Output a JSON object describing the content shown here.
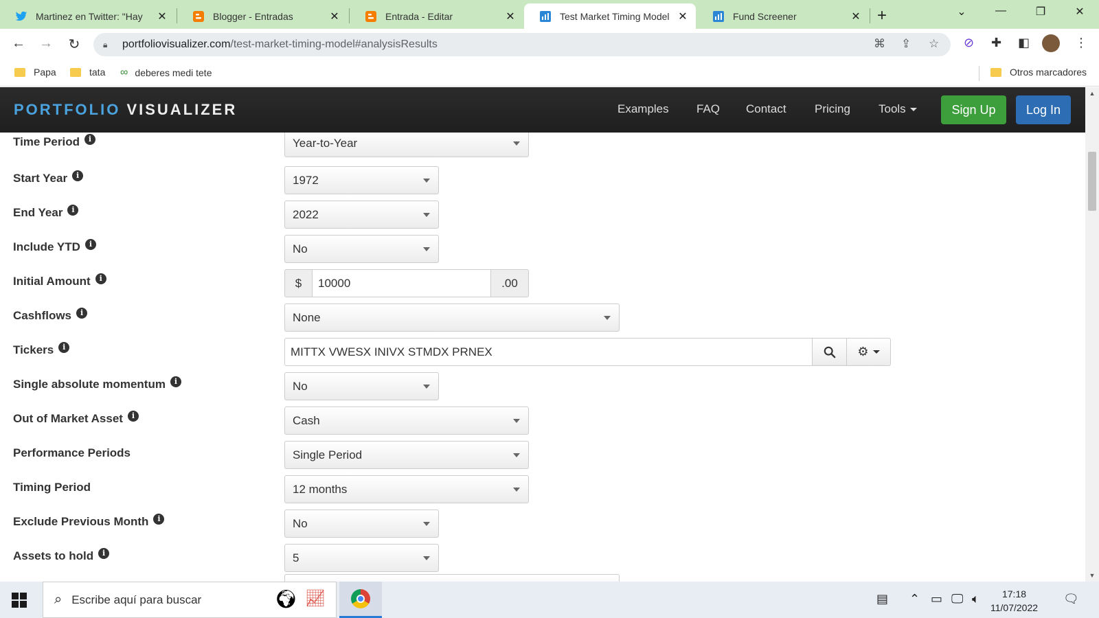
{
  "browser": {
    "tabs": [
      {
        "title": "Martinez en Twitter: \"Hay",
        "icon": "twitter-icon",
        "active": false
      },
      {
        "title": "Blogger - Entradas",
        "icon": "blogger-icon",
        "active": false
      },
      {
        "title": "Entrada - Editar",
        "icon": "blogger-icon",
        "active": false
      },
      {
        "title": "Test Market Timing Model",
        "icon": "portfolio-visualizer-icon",
        "active": true
      },
      {
        "title": "Fund Screener",
        "icon": "portfolio-visualizer-icon",
        "active": false
      }
    ],
    "url_host": "portfoliovisualizer.com",
    "url_path": "/test-market-timing-model#analysisResults",
    "bookmarks": [
      "Papa",
      "tata",
      "deberes medi tete"
    ],
    "other_bookmarks": "Otros marcadores"
  },
  "site": {
    "brand_part1": "PORTFOLIO",
    "brand_part2": "VISUALIZER",
    "nav": {
      "examples": "Examples",
      "faq": "FAQ",
      "contact": "Contact",
      "pricing": "Pricing",
      "tools": "Tools",
      "signup": "Sign Up",
      "login": "Log In"
    }
  },
  "form": {
    "time_period": {
      "label": "Time Period",
      "value": "Year-to-Year"
    },
    "start_year": {
      "label": "Start Year",
      "value": "1972"
    },
    "end_year": {
      "label": "End Year",
      "value": "2022"
    },
    "include_ytd": {
      "label": "Include YTD",
      "value": "No"
    },
    "initial_amount": {
      "label": "Initial Amount",
      "prefix": "$",
      "value": "10000",
      "suffix": ".00"
    },
    "cashflows": {
      "label": "Cashflows",
      "value": "None"
    },
    "tickers": {
      "label": "Tickers",
      "value": "MITTX VWESX INIVX STMDX PRNEX"
    },
    "single_abs_momentum": {
      "label": "Single absolute momentum",
      "value": "No"
    },
    "out_of_market_asset": {
      "label": "Out of Market Asset",
      "value": "Cash"
    },
    "performance_periods": {
      "label": "Performance Periods",
      "value": "Single Period"
    },
    "timing_period": {
      "label": "Timing Period",
      "value": "12 months"
    },
    "exclude_prev_month": {
      "label": "Exclude Previous Month",
      "value": "No"
    },
    "assets_to_hold": {
      "label": "Assets to hold",
      "value": "5"
    }
  },
  "taskbar": {
    "search_placeholder": "Escribe aquí para buscar",
    "time": "17:18",
    "date": "11/07/2022"
  },
  "colors": {
    "tabbar_bg": "#c9e8c2",
    "brand_blue": "#4aa3df",
    "signup_green": "#3c9f3c",
    "login_blue": "#2c6db3"
  }
}
